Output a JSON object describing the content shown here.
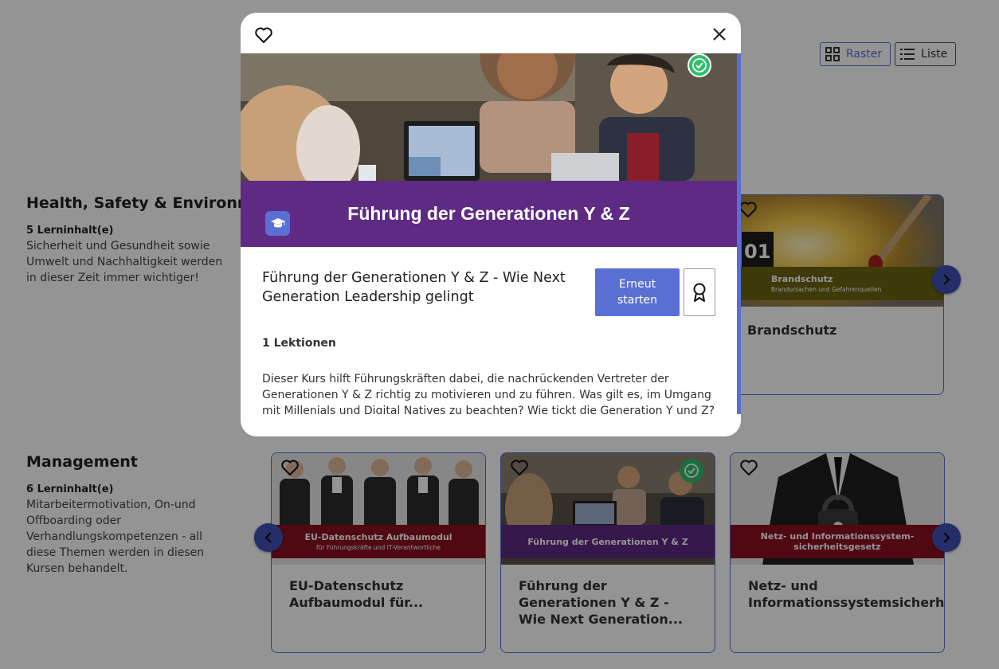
{
  "view_toggle": {
    "grid_label": "Raster",
    "list_label": "Liste"
  },
  "sections": [
    {
      "title": "Health, Safety & Environment",
      "count": "5 Lerninhalt(e)",
      "description": "Sicherheit und Gesundheit sowie Umwelt und Nachhaltigkeit werden in dieser Zeit immer wichtiger!",
      "cards": [
        {
          "title": "Brandschutz",
          "banner_title": "Brandschutz",
          "banner_subtitle": "Brandursachen und Gefahrenquellen",
          "number": "01"
        }
      ]
    },
    {
      "title": "Management",
      "count": "6 Lerninhalt(e)",
      "description": "Mitarbeitermotivation, On-und Offboarding oder Verhandlungskompetenzen - all diese Themen werden in diesen Kursen behandelt.",
      "cards": [
        {
          "title": "EU-Datenschutz Aufbaumodul für...",
          "banner_title": "EU-Datenschutz Aufbaumodul",
          "banner_subtitle": "für Führungskräfte und IT-Verantwortliche"
        },
        {
          "title": "Führung der Generationen Y & Z - Wie Next Generation...",
          "banner_title": "Führung der Generationen Y & Z",
          "completed": true
        },
        {
          "title": "Netz- und Informationssystemsicherhe",
          "banner_title": "Netz- und Informationssystem-",
          "banner_subtitle": "sicherheitsgesetz"
        }
      ]
    }
  ],
  "modal": {
    "banner_title": "Führung der Generationen Y & Z",
    "course_title": "Führung der Generationen Y & Z - Wie Next Generation Leadership gelingt",
    "restart_label": "Erneut starten",
    "lessons": "1 Lektionen",
    "description": "Dieser Kurs hilft Führungskräften dabei, die nachrückenden Vertreter der Generationen Y & Z richtig zu motivieren und zu führen. Was gilt es, im Umgang mit Millenials und Digital Natives zu beachten? Wie tickt die Generation Y und Z? Und wie",
    "completed": true
  },
  "colors": {
    "accent": "#5a6fd4",
    "nav_arrow": "#3e51b5",
    "purple_band": "#5e2a84",
    "red_banner": "#8a0f22",
    "olive_banner": "#6b6410",
    "completed_green": "#2fc06b"
  },
  "icons": [
    "heart-icon",
    "close-icon",
    "check-circle-icon",
    "graduation-cap-icon",
    "award-ribbon-icon",
    "grid-icon",
    "list-icon",
    "chevron-left-icon",
    "chevron-right-icon"
  ]
}
